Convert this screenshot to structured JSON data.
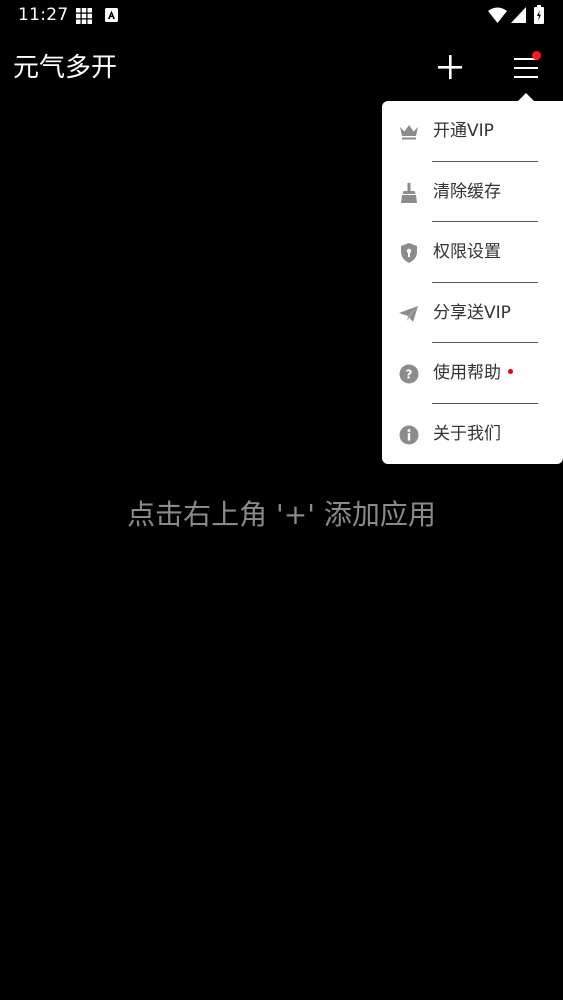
{
  "status_bar": {
    "time": "11:27",
    "icons": [
      "grid-icon",
      "a-icon",
      "wifi-icon",
      "signal-icon",
      "battery-icon"
    ]
  },
  "app_bar": {
    "title": "元气多开",
    "add_icon": "plus-icon",
    "menu_icon": "hamburger-icon",
    "menu_badge_color": "#ff1a1a"
  },
  "popup_menu": {
    "items": [
      {
        "label": "开通VIP",
        "icon": "crown-icon",
        "dot": false
      },
      {
        "label": "清除缓存",
        "icon": "broom-icon",
        "dot": false
      },
      {
        "label": "权限设置",
        "icon": "shield-icon",
        "dot": false
      },
      {
        "label": "分享送VIP",
        "icon": "paper-plane-icon",
        "dot": false
      },
      {
        "label": "使用帮助",
        "icon": "help-icon",
        "dot": true
      },
      {
        "label": "关于我们",
        "icon": "info-icon",
        "dot": false
      }
    ],
    "icon_color": "#8c8c8c",
    "dot_color": "#e60012"
  },
  "main": {
    "empty_hint": "点击右上角 '+' 添加应用"
  }
}
